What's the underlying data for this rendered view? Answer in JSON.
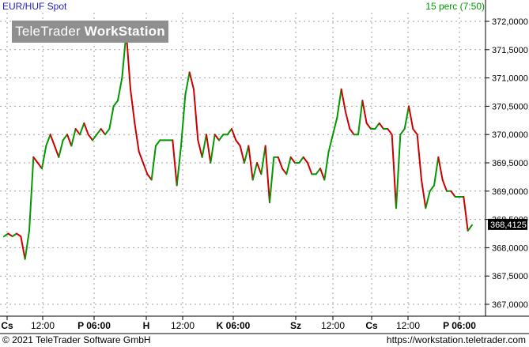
{
  "header": {
    "instrument": "EUR/HUF Spot",
    "timeframe": "15 perc (7:50)"
  },
  "logo": {
    "part1": "TeleTrader",
    "part2": "WorkStation"
  },
  "footer": {
    "copyright": "© 2021 TeleTrader Software GmbH",
    "url": "https://workstation.teletrader.com"
  },
  "colors": {
    "up": "#009900",
    "down": "#cc0000",
    "grid": "#a0a0a0"
  },
  "chart_data": {
    "type": "line",
    "title": "EUR/HUF Spot",
    "ylim": [
      366.6,
      372.3
    ],
    "y_ticks": [
      "372,0000",
      "371,5000",
      "371,0000",
      "370,5000",
      "370,0000",
      "369,5000",
      "369,0000",
      "368,5000",
      "368,0000",
      "367,5000",
      "367,0000"
    ],
    "y_tick_values": [
      372.0,
      371.5,
      371.0,
      370.5,
      370.0,
      369.5,
      369.0,
      368.5,
      368.0,
      367.5,
      367.0
    ],
    "x_ticks": [
      "Cs",
      "12:00",
      "P 06:00",
      "H",
      "12:00",
      "K 06:00",
      "Sz",
      "12:00",
      "Cs",
      "12:00",
      "P 06:00"
    ],
    "last_value": 368.4125,
    "last_label": "368,4125",
    "series": [
      {
        "values": [
          368.2,
          368.25,
          368.2,
          368.25,
          368.2,
          367.8,
          368.3,
          369.6,
          369.5,
          369.4,
          369.8,
          370.0,
          369.8,
          369.6,
          369.9,
          370.0,
          369.8,
          370.1,
          370.0,
          370.2,
          370.0,
          369.9,
          370.0,
          370.1,
          370.0,
          370.1,
          370.5,
          370.6,
          371.0,
          371.8,
          370.8,
          370.2,
          369.7,
          369.5,
          369.3,
          369.2,
          369.8,
          369.9,
          369.9,
          369.9,
          369.9,
          369.1,
          369.8,
          370.7,
          371.1,
          370.8,
          369.9,
          369.6,
          370.0,
          369.5,
          370.0,
          369.9,
          370.0,
          370.0,
          370.1,
          369.9,
          369.8,
          369.5,
          369.8,
          369.2,
          369.5,
          369.3,
          369.8,
          368.8,
          369.6,
          369.6,
          369.4,
          369.3,
          369.6,
          369.5,
          369.5,
          369.6,
          369.5,
          369.3,
          369.3,
          369.4,
          369.2,
          369.7,
          370.0,
          370.3,
          370.8,
          370.4,
          370.1,
          370.0,
          370.0,
          370.6,
          370.2,
          370.1,
          370.1,
          370.2,
          370.1,
          370.1,
          370.0,
          368.7,
          370.0,
          370.1,
          370.5,
          370.1,
          370.0,
          369.2,
          368.7,
          369.0,
          369.1,
          369.6,
          369.2,
          369.0,
          369.0,
          368.9,
          368.9,
          368.9,
          368.3,
          368.4
        ]
      }
    ]
  }
}
